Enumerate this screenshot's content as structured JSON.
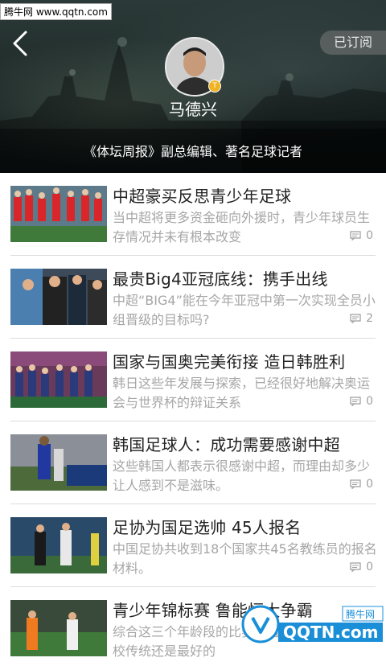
{
  "watermark_top": "腾牛网 www.qqtn.com",
  "header": {
    "subscribe_label": "已订阅",
    "author_name": "马德兴",
    "badge": "T",
    "author_desc": "《体坛周报》副总编辑、著名足球记者"
  },
  "articles": [
    {
      "title": "中超豪买反思青少年足球",
      "summary": "当中超将更多资金砸向外援时，青少年球员生存情况并未有根本改变",
      "comments": "0"
    },
    {
      "title": "最贵Big4亚冠底线：携手出线",
      "summary": "中超“BIG4”能在今年亚冠中第一次实现全员小组晋级的目标吗?",
      "comments": "2"
    },
    {
      "title": "国家与国奥完美衔接 造日韩胜利",
      "summary": "韩日这些年发展与探索，已经很好地解决奥运会与世界杯的辩证关系",
      "comments": "0"
    },
    {
      "title": "韩国足球人：成功需要感谢中超",
      "summary": "这些韩国人都表示很感谢中超，而理由却多少让人感到不是滋味。",
      "comments": "0"
    },
    {
      "title": "足协为国足选帅 45人报名",
      "summary": "中国足协共收到18个国家共45名教练员的报名材料。",
      "comments": "0"
    },
    {
      "title": "青少年锦标赛 鲁能恒大争霸",
      "summary": "综合这三个年龄段的比赛来看，恒大和鲁能足校传统还是最好的",
      "comments": ""
    }
  ],
  "logo": {
    "text": "QQTN.com",
    "tag": "腾牛网"
  },
  "colors": {
    "accent": "#f0b323",
    "logo_blue": "#1a8fd8"
  }
}
